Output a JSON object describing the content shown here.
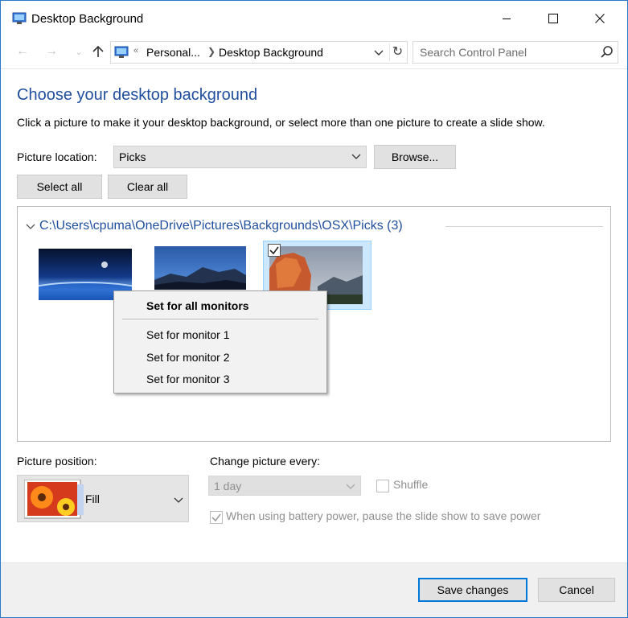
{
  "window": {
    "title": "Desktop Background",
    "controls": {
      "minimize": "minimize",
      "maximize": "maximize",
      "close": "close"
    }
  },
  "navigation": {
    "breadcrumb": [
      "Personal...",
      "Desktop Background"
    ],
    "search_placeholder": "Search Control Panel"
  },
  "page": {
    "heading": "Choose your desktop background",
    "description": "Click a picture to make it your desktop background, or select more than one picture to create a slide show."
  },
  "picture_location": {
    "label": "Picture location:",
    "value": "Picks",
    "browse_label": "Browse..."
  },
  "selection_buttons": {
    "select_all": "Select all",
    "clear_all": "Clear all"
  },
  "gallery": {
    "group_title": "C:\\Users\\cpuma\\OneDrive\\Pictures\\Backgrounds\\OSX\\Picks (3)",
    "thumbnails": [
      {
        "name": "space-earth",
        "selected": false
      },
      {
        "name": "yosemite-night",
        "selected": false
      },
      {
        "name": "el-capitan",
        "selected": true
      }
    ]
  },
  "context_menu": {
    "items": [
      "Set for all monitors",
      "Set for monitor 1",
      "Set for monitor 2",
      "Set for monitor 3"
    ]
  },
  "picture_position": {
    "label": "Picture position:",
    "value": "Fill"
  },
  "slideshow": {
    "change_label": "Change picture every:",
    "interval": "1 day",
    "shuffle_label": "Shuffle",
    "shuffle_checked": false,
    "battery_label": "When using battery power, pause the slide show to save power",
    "battery_checked": true
  },
  "footer": {
    "save_label": "Save changes",
    "cancel_label": "Cancel"
  },
  "colors": {
    "heading": "#1f4e9e",
    "selection_bg": "#cce8ff",
    "primary_button_border": "#0078d7"
  }
}
